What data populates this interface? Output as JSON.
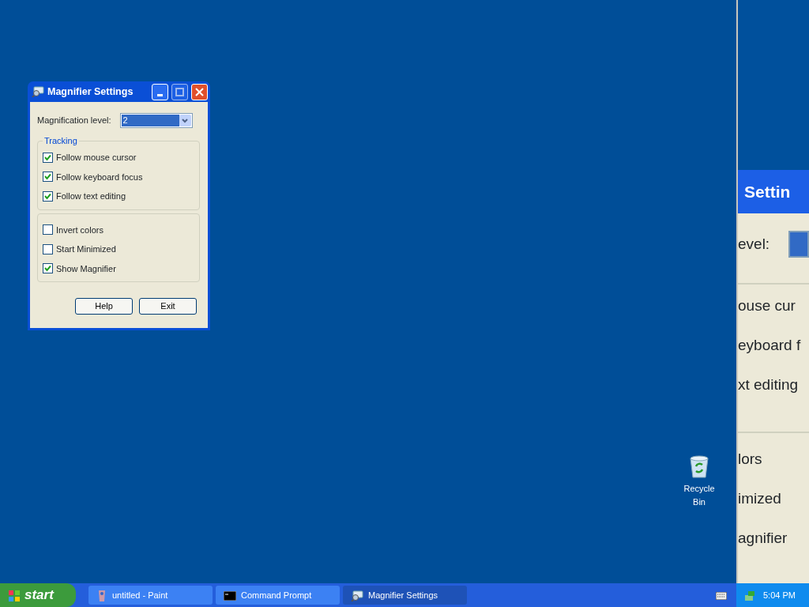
{
  "dialog": {
    "title": "Magnifier Settings",
    "magnification_label": "Magnification level:",
    "magnification_value": "2",
    "groups": [
      {
        "label": "Tracking",
        "options": [
          {
            "label": "Follow mouse cursor",
            "checked": true
          },
          {
            "label": "Follow keyboard focus",
            "checked": true
          },
          {
            "label": "Follow text editing",
            "checked": true
          }
        ]
      },
      {
        "options": [
          {
            "label": "Invert colors",
            "checked": false
          },
          {
            "label": "Start Minimized",
            "checked": false
          },
          {
            "label": "Show Magnifier",
            "checked": true
          }
        ]
      }
    ],
    "buttons": [
      "Help",
      "Exit"
    ]
  },
  "desktop_icons": [
    {
      "label": "Recycle Bin"
    }
  ],
  "magnifier_view": {
    "title": "Settin",
    "level_label": "evel:",
    "groups": [
      [
        "ouse cur",
        "eyboard f",
        "xt editing"
      ],
      [
        "lors",
        "imized",
        "agnifier"
      ]
    ]
  },
  "taskbar": {
    "start": "start",
    "tasks": [
      {
        "label": "untitled - Paint",
        "kind": "paint",
        "selected": false
      },
      {
        "label": "Command Prompt",
        "kind": "console",
        "selected": false
      },
      {
        "label": "Magnifier Settings",
        "kind": "magnifier",
        "selected": true
      }
    ],
    "clock": "5:04 PM"
  }
}
